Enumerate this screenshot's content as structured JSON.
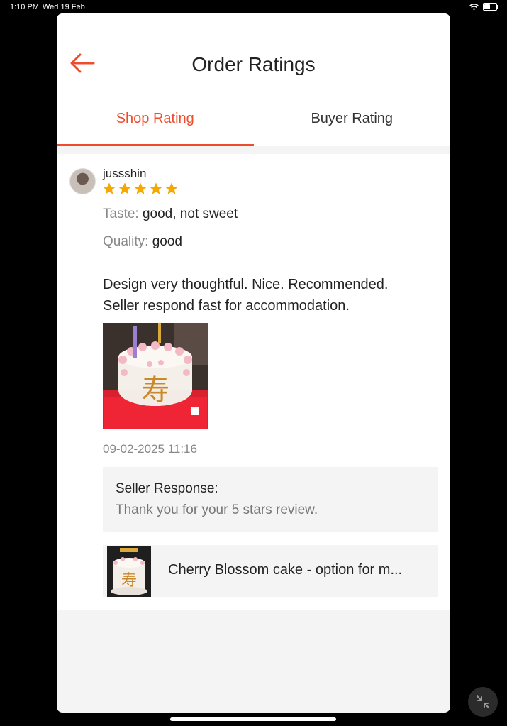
{
  "status_bar": {
    "time": "1:10 PM",
    "date": "Wed 19 Feb",
    "icons": [
      "wifi-icon",
      "battery-icon"
    ],
    "battery_level": 0.5
  },
  "header": {
    "title": "Order Ratings",
    "back_icon": "arrow-left-icon"
  },
  "tabs": [
    {
      "label": "Shop Rating",
      "active": true
    },
    {
      "label": "Buyer Rating",
      "active": false
    }
  ],
  "review": {
    "username": "jussshin",
    "rating": 5,
    "attributes": [
      {
        "label": "Taste:",
        "value": "good, not sweet"
      },
      {
        "label": "Quality:",
        "value": "good"
      }
    ],
    "comment_lines": [
      "Design very thoughtful. Nice. Recommended.",
      "Seller respond fast for accommodation."
    ],
    "photo_alt_character": "寿",
    "date": "09-02-2025 11:16",
    "seller_response": {
      "title": "Seller Response:",
      "text": "Thank you for your 5 stars review."
    },
    "product": {
      "name": "Cherry Blossom cake - option for m...",
      "thumb_character": "寿"
    }
  },
  "colors": {
    "accent": "#ee4d2d",
    "star": "#f6a700",
    "muted_text": "#888888",
    "panel_bg": "#f4f4f4"
  }
}
